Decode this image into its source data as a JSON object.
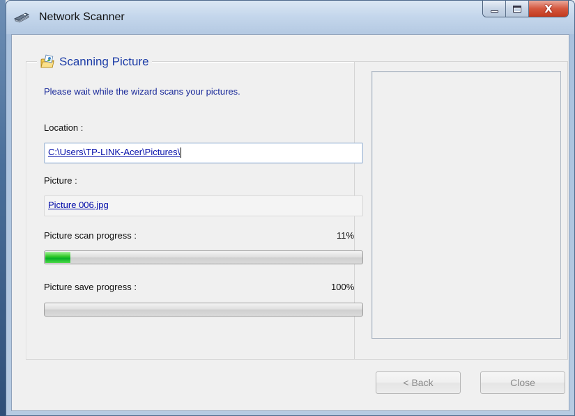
{
  "window": {
    "title": "Network Scanner",
    "controls": {
      "minimize": "minimize",
      "maximize": "maximize",
      "close": "X"
    }
  },
  "section": {
    "title": "Scanning Picture",
    "instruction": "Please wait while the wizard scans your pictures."
  },
  "location": {
    "label": "Location :",
    "value": "C:\\Users\\TP-LINK-Acer\\Pictures\\"
  },
  "picture": {
    "label": "Picture :",
    "value": "Picture 006.jpg"
  },
  "scan_progress": {
    "label": "Picture scan progress :",
    "percent_text": "11%",
    "value": 0.08
  },
  "save_progress": {
    "label": "Picture save progress :",
    "percent_text": "100%",
    "value": 0.0
  },
  "buttons": {
    "back": "< Back",
    "close": "Close"
  },
  "colors": {
    "accent_text": "#1e3ea8",
    "progress_green": "#06b025",
    "link_blue": "#000aa8"
  },
  "icons": {
    "title": "scanner-icon",
    "section": "folder-picture-icon"
  }
}
